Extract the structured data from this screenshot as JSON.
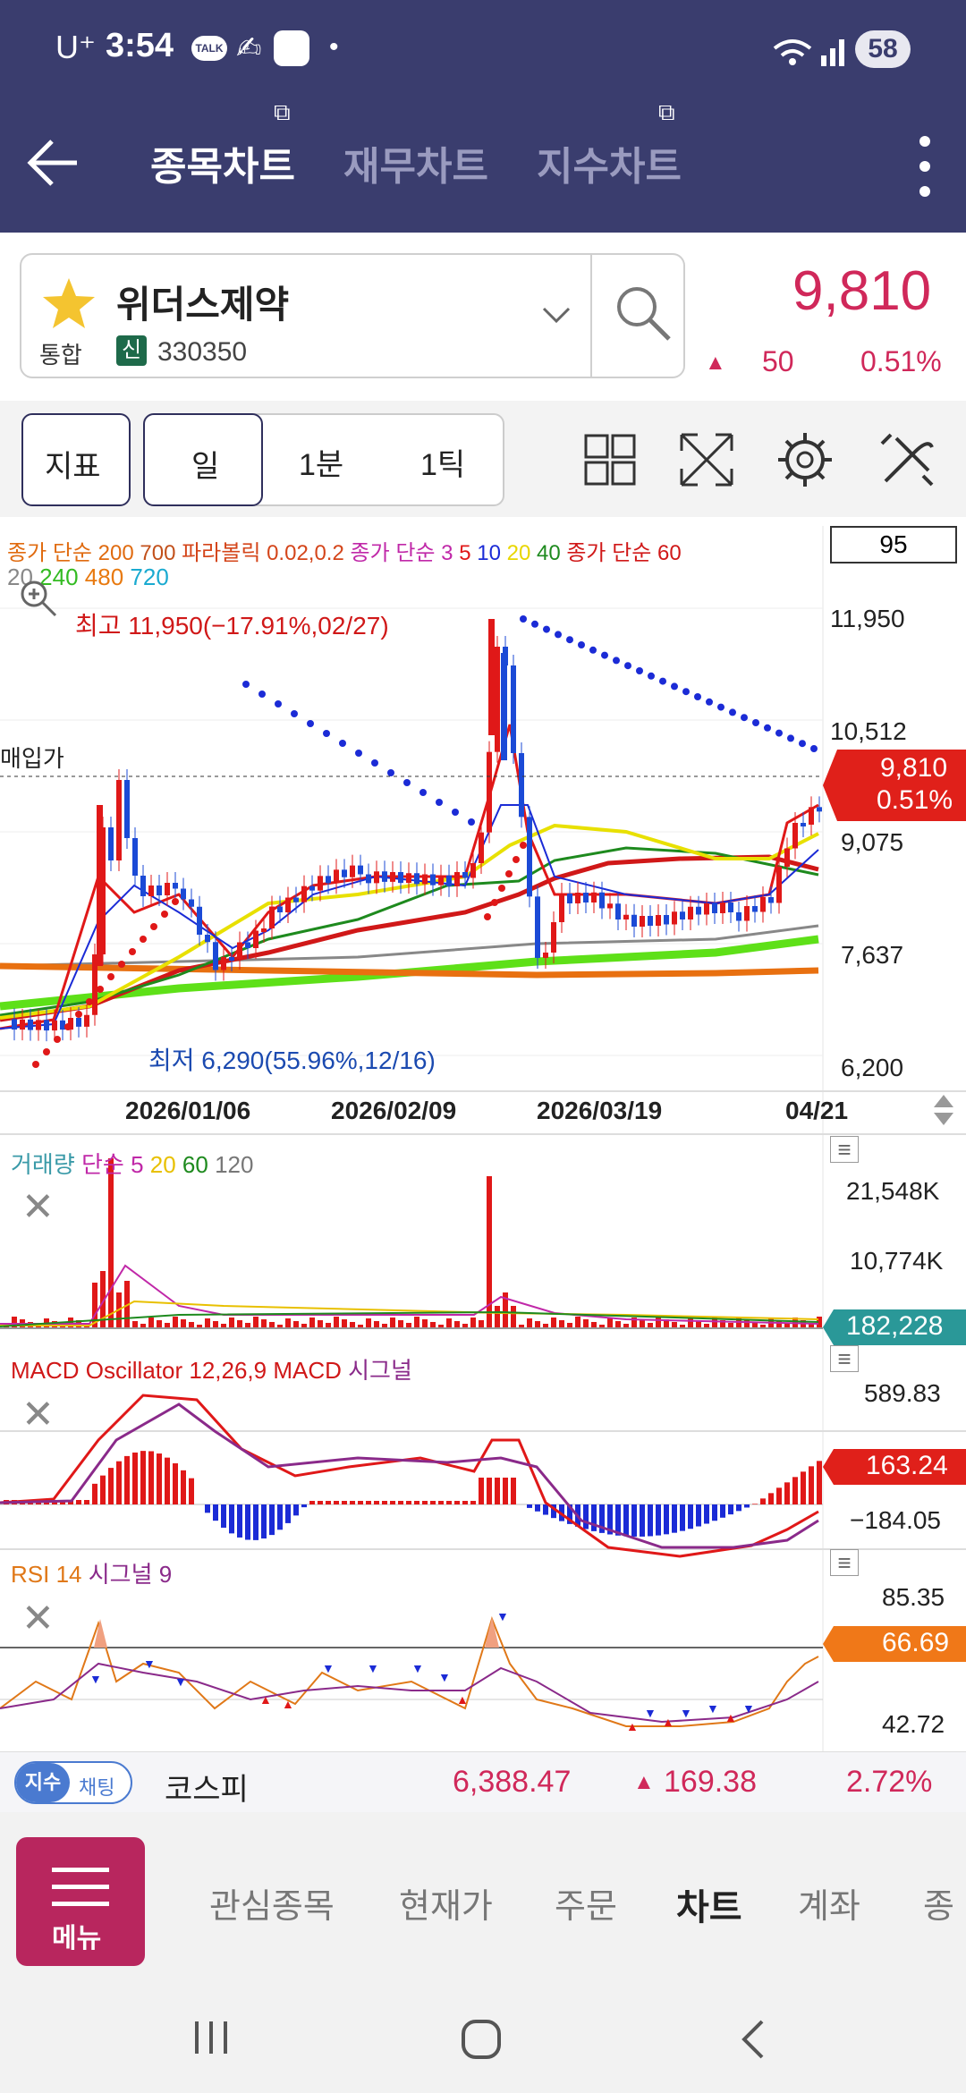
{
  "status_bar": {
    "carrier": "U⁺",
    "time": "3:54",
    "battery": "58",
    "talk_badge": "TALK"
  },
  "tabs": [
    {
      "label": "종목차트",
      "active": true
    },
    {
      "label": "재무차트",
      "active": false
    },
    {
      "label": "지수차트",
      "active": false
    }
  ],
  "stock": {
    "name": "위더스제약",
    "market": "통합",
    "credit_badge": "신",
    "code": "330350",
    "price": "9,810",
    "change": "50",
    "change_pct": "0.51%"
  },
  "toolbar": {
    "indicator_label": "지표",
    "periods": [
      "일",
      "1분",
      "1틱"
    ]
  },
  "main_chart": {
    "legend_line1": [
      {
        "text": "종가 단순 200",
        "color": "#e06b10"
      },
      {
        "text": "700",
        "color": "#c2501b"
      },
      {
        "text": "파라볼릭 0.02,0.2",
        "color": "#d4451a"
      },
      {
        "text": "종가 단순 3",
        "color": "#c028a8"
      },
      {
        "text": "5",
        "color": "#e01818"
      },
      {
        "text": "10",
        "color": "#1b2bd6"
      },
      {
        "text": "20",
        "color": "#e8d600"
      },
      {
        "text": "40",
        "color": "#1e8a1e"
      },
      {
        "text": "종가 단순 60",
        "color": "#d01818"
      }
    ],
    "legend_line2": [
      {
        "text": "20",
        "color": "#888888"
      },
      {
        "text": "240",
        "color": "#33bb22"
      },
      {
        "text": "480",
        "color": "#e87a10"
      },
      {
        "text": "720",
        "color": "#1aaad0"
      }
    ],
    "count_box": "95",
    "high_label": "최고 11,950(−17.91%,02/27)",
    "low_label": "최저 6,290(55.96%,12/16)",
    "buy_price_label": "매입가",
    "y_ticks": [
      "11,950",
      "10,512",
      "9,075",
      "7,637",
      "6,200"
    ],
    "price_tag": {
      "price": "9,810",
      "pct": "0.51%"
    },
    "dates": [
      "2026/01/06",
      "2026/02/09",
      "2026/03/19",
      "04/21"
    ]
  },
  "volume": {
    "legend": [
      {
        "text": "거래량",
        "color": "#3a9aa8"
      },
      {
        "text": "단순 5",
        "color": "#c028a8"
      },
      {
        "text": "20",
        "color": "#e8c000"
      },
      {
        "text": "60",
        "color": "#1e8a1e"
      },
      {
        "text": "120",
        "color": "#777777"
      }
    ],
    "y_ticks": [
      "21,548K",
      "10,774K"
    ],
    "tag": "182,228"
  },
  "macd": {
    "legend": [
      {
        "text": "MACD Oscillator 12,26,9",
        "color": "#d01818"
      },
      {
        "text": "MACD",
        "color": "#d01818"
      },
      {
        "text": "시그널",
        "color": "#8a2a8a"
      }
    ],
    "y_ticks": [
      "589.83",
      "−184.05"
    ],
    "tag": "163.24"
  },
  "rsi": {
    "legend": [
      {
        "text": "RSI 14",
        "color": "#e07818"
      },
      {
        "text": "시그널 9",
        "color": "#8a2a8a"
      }
    ],
    "y_ticks": [
      "85.35",
      "42.72"
    ],
    "tag": "66.69"
  },
  "index_bar": {
    "badge_left": "지수",
    "badge_right": "채팅",
    "name": "코스피",
    "value": "6,388.47",
    "change": "169.38",
    "pct": "2.72%"
  },
  "bottom_nav": {
    "menu_label": "메뉴",
    "items": [
      "관심종목",
      "현재가",
      "주문",
      "차트",
      "계좌",
      "종"
    ]
  },
  "colors": {
    "header": "#3a3d6e",
    "up": "#d0285a",
    "menu": "#b8265e",
    "accent_red": "#e0201a"
  }
}
